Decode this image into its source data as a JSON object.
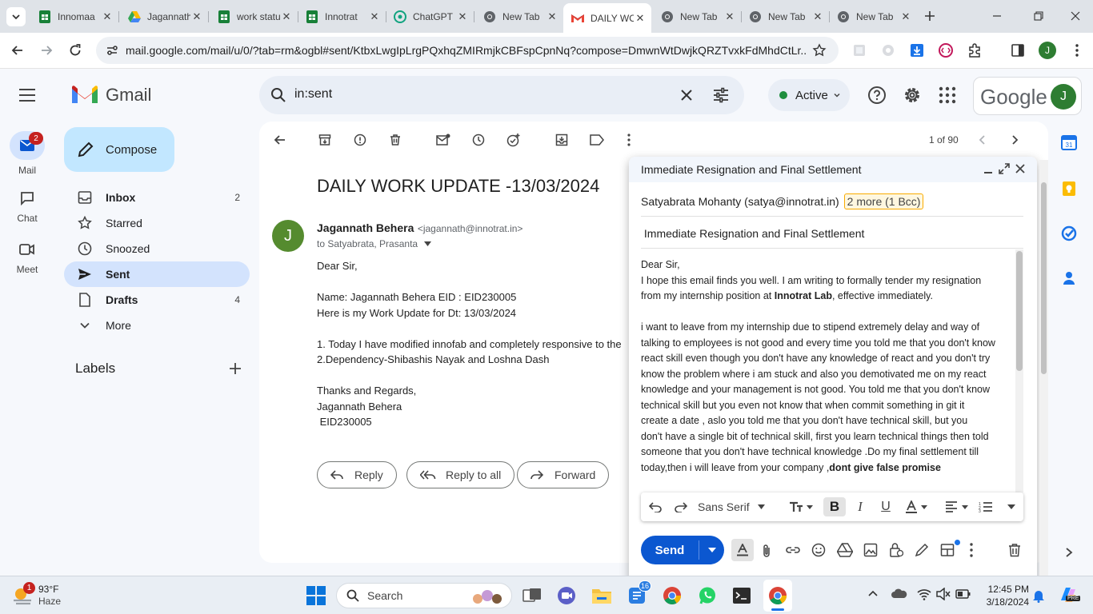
{
  "browser": {
    "tabs": [
      {
        "title": "Innomaa",
        "icon": "sheets-icon"
      },
      {
        "title": "Jagannath",
        "icon": "drive-icon"
      },
      {
        "title": "work status",
        "icon": "sheets-icon"
      },
      {
        "title": "Innotrat",
        "icon": "sheets-icon"
      },
      {
        "title": "ChatGPT",
        "icon": "chatgpt-icon"
      },
      {
        "title": "New Tab",
        "icon": "chrome-icon"
      },
      {
        "title": "DAILY WORK",
        "icon": "gmail-icon"
      },
      {
        "title": "New Tab",
        "icon": "chrome-icon"
      },
      {
        "title": "New Tab",
        "icon": "chrome-icon"
      },
      {
        "title": "New Tab",
        "icon": "chrome-icon"
      }
    ],
    "url": "mail.google.com/mail/u/0/?tab=rm&ogbl#sent/KtbxLwgIpLrgPQxhqZMIRmjkCBFspCpnNq?compose=DmwnWtDwjkQRZTvxkFdMhdCtLr...",
    "profile_initial": "J"
  },
  "gmail": {
    "brand": "Gmail",
    "search_value": "in:sent",
    "status": "Active",
    "google_label": "Google",
    "account_initial": "J",
    "rail": {
      "mail": "Mail",
      "mail_badge": "2",
      "chat": "Chat",
      "meet": "Meet"
    },
    "compose_label": "Compose",
    "nav": [
      {
        "label": "Inbox",
        "count": "2"
      },
      {
        "label": "Starred",
        "count": ""
      },
      {
        "label": "Snoozed",
        "count": ""
      },
      {
        "label": "Sent",
        "count": ""
      },
      {
        "label": "Drafts",
        "count": "4"
      },
      {
        "label": "More",
        "count": ""
      }
    ],
    "labels_heading": "Labels",
    "pagination": "1 of 90"
  },
  "email": {
    "subject": "DAILY WORK UPDATE -13/03/2024",
    "sender_initial": "J",
    "sender_name": "Jagannath Behera",
    "sender_email": "<jagannath@innotrat.in>",
    "recipients": "to Satyabrata, Prasanta",
    "body": [
      "Dear Sir,",
      "Name: Jagannath Behera  EID : EID230005",
      "Here is my Work Update for Dt: 13/03/2024",
      "1. Today I have modified innofab and completely  responsive  to the",
      "2.Dependency-Shibashis Nayak and Loshna Dash",
      "Thanks and Regards,",
      "Jagannath Behera",
      " EID230005"
    ],
    "reply_label": "Reply",
    "reply_all_label": "Reply to all",
    "forward_label": "Forward"
  },
  "compose": {
    "title": "Immediate Resignation and Final Settlement",
    "to": "Satyabrata Mohanty (satya@innotrat.in)",
    "more_recipients": "2 more (1 Bcc)",
    "subject": " Immediate Resignation and Final Settlement",
    "body": {
      "greeting": "Dear Sir,",
      "p1_a": "I hope this email finds you well. I am writing to formally tender my resignation",
      "p1_b": "from my internship position at ",
      "p1_bold": "Innotrat Lab",
      "p1_c": ", effective immediately.",
      "p2": [
        "i want to leave from my internship due to stipend extremely delay and way of",
        "talking to employees is not good and every time you told me that you don't know",
        "react skill even though you don't have any knowledge of react and you  don't try",
        "know the problem where i am stuck  and also you demotivated me on my react",
        "knowledge and your  management is not good.  You told me that you don't know",
        "technical skill but you even not know that  when  commit something in  git it",
        "create a date  , aslo you told me that you don't have technical skill, but you",
        "don't  have a single bit of technical skill, first you learn  technical things then told",
        "someone that you don't have technical knowledge  .Do my final settlement till"
      ],
      "p2_last": "today,then i will leave from  your company ,",
      "p2_last_bold": "dont give false promise"
    },
    "font_name": "Sans Serif",
    "send_label": "Send"
  },
  "taskbar": {
    "weather_temp": "93°F",
    "weather_desc": "Haze",
    "weather_badge": "1",
    "search_label": "Search",
    "teams_badge": "16",
    "time": "12:45 PM",
    "date": "3/18/2024"
  },
  "colors": {
    "accent_blue": "#0b57d0",
    "selected_nav": "#d3e3fd",
    "compose_btn": "#c2e7ff",
    "avatar_green": "#2e7d32",
    "active_dot": "#1e8e3e"
  }
}
